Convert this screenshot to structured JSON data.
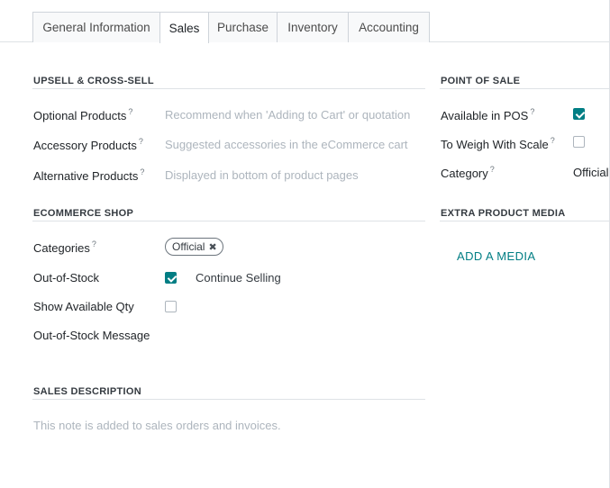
{
  "tabs": [
    {
      "label": "General Information"
    },
    {
      "label": "Sales"
    },
    {
      "label": "Purchase"
    },
    {
      "label": "Inventory"
    },
    {
      "label": "Accounting"
    }
  ],
  "upsell": {
    "title": "UPSELL & CROSS-SELL",
    "optional_label": "Optional Products",
    "optional_placeholder": "Recommend when 'Adding to Cart' or quotation",
    "accessory_label": "Accessory Products",
    "accessory_placeholder": "Suggested accessories in the eCommerce cart",
    "alternative_label": "Alternative Products",
    "alternative_placeholder": "Displayed in bottom of product pages"
  },
  "ecommerce": {
    "title": "ECOMMERCE SHOP",
    "categories_label": "Categories",
    "category_tag": "Official",
    "out_of_stock_label": "Out-of-Stock",
    "out_of_stock_checked": true,
    "continue_selling": "Continue Selling",
    "show_qty_label": "Show Available Qty",
    "show_qty_checked": false,
    "oos_message_label": "Out-of-Stock Message"
  },
  "sales_description": {
    "title": "SALES DESCRIPTION",
    "placeholder": "This note is added to sales orders and invoices."
  },
  "pos": {
    "title": "POINT OF SALE",
    "available_label": "Available in POS",
    "available_checked": true,
    "weigh_label": "To Weigh With Scale",
    "weigh_checked": false,
    "category_label": "Category",
    "category_value": "Official"
  },
  "media": {
    "title": "EXTRA PRODUCT MEDIA",
    "add_label": "ADD A MEDIA"
  },
  "help_mark": "?",
  "tag_remove": "✖",
  "accent_color": "#017e84"
}
